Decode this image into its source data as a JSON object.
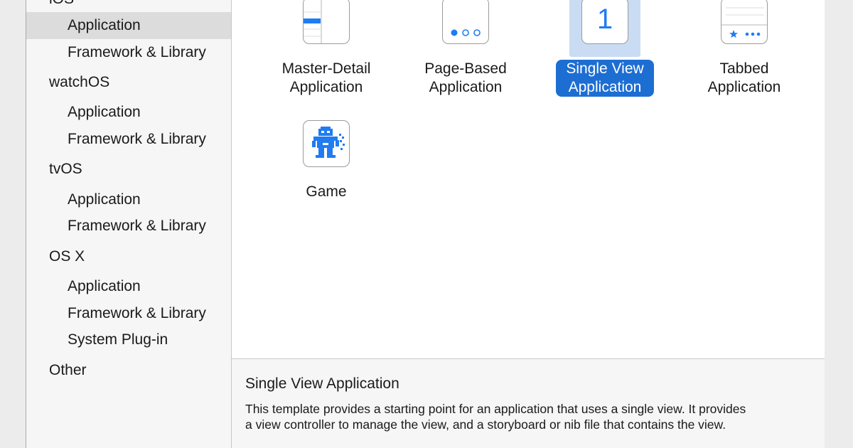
{
  "sidebar": {
    "partial_top": "iOS",
    "rows": [
      {
        "label": "Application",
        "kind": "item",
        "selected": true
      },
      {
        "label": "Framework & Library",
        "kind": "item"
      },
      {
        "label": "watchOS",
        "kind": "section"
      },
      {
        "label": "Application",
        "kind": "item"
      },
      {
        "label": "Framework & Library",
        "kind": "item"
      },
      {
        "label": "tvOS",
        "kind": "section"
      },
      {
        "label": "Application",
        "kind": "item"
      },
      {
        "label": "Framework & Library",
        "kind": "item"
      },
      {
        "label": "OS X",
        "kind": "section"
      },
      {
        "label": "Application",
        "kind": "item"
      },
      {
        "label": "Framework & Library",
        "kind": "item"
      },
      {
        "label": "System Plug-in",
        "kind": "item"
      },
      {
        "label": "Other",
        "kind": "section"
      }
    ]
  },
  "templates": [
    {
      "line1": "Master-Detail",
      "line2": "Application",
      "icon": "master-detail-icon"
    },
    {
      "line1": "Page-Based",
      "line2": "Application",
      "icon": "page-dots-icon"
    },
    {
      "line1": "Single View",
      "line2": "Application",
      "icon": "single-view-icon",
      "icon_text": "1",
      "selected": true
    },
    {
      "line1": "Tabbed",
      "line2": "Application",
      "icon": "tab-bar-icon"
    },
    {
      "line1": "Game",
      "line2": "",
      "icon": "game-robot-icon"
    }
  ],
  "description": {
    "title": "Single View Application",
    "line1": "This template provides a starting point for an application that uses a single view. It provides",
    "line2": "a view controller to manage the view, and a storyboard or nib file that contains the view."
  },
  "colors": {
    "accent": "#1d6ed3",
    "selection_bg": "#c9dcf3",
    "icon_blue": "#1f7cf2"
  }
}
